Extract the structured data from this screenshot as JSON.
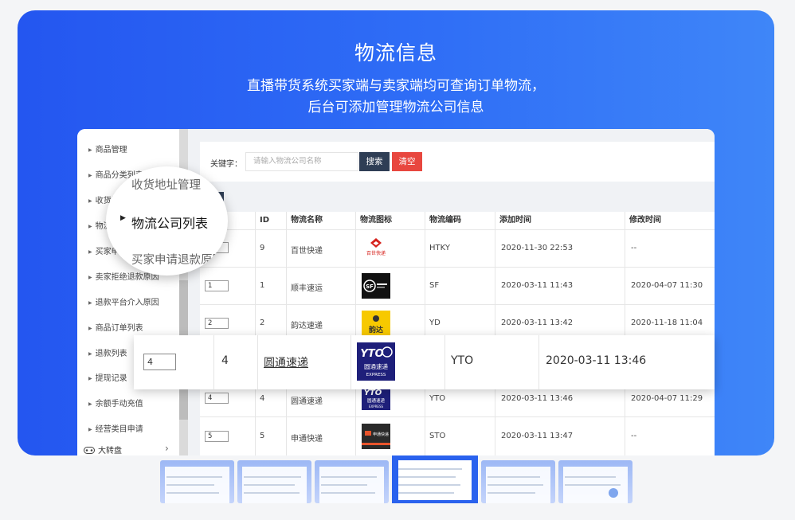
{
  "hero": {
    "title": "物流信息",
    "subtitle_line1": "直播带货系统买家端与卖家端均可查询订单物流，",
    "subtitle_line2": "后台可添加管理物流公司信息"
  },
  "sidebar": {
    "items": [
      "商品管理",
      "商品分类列表",
      "收货地址",
      "物流公",
      "买家申请",
      "卖家拒绝退款原因",
      "退款平台介入原因",
      "商品订单列表",
      "退款列表",
      "提现记录",
      "余额手动充值",
      "经营类目申请"
    ],
    "bottom": {
      "label": "大转盘",
      "icon": "gamepad-icon"
    }
  },
  "magnifier": {
    "items": [
      "收货地址管理",
      "物流公司列表",
      "买家申请退款原因"
    ],
    "active_index": 1
  },
  "search": {
    "label": "关键字：",
    "placeholder": "请输入物流公司名称",
    "search_btn": "搜索",
    "clear_btn": "清空"
  },
  "table": {
    "headers": [
      "ID",
      "物流名称",
      "物流图标",
      "物流编码",
      "添加时间",
      "修改时间"
    ],
    "rows": [
      {
        "order": "",
        "id": "9",
        "name": "百世快递",
        "icon": "best-express-logo",
        "code": "HTKY",
        "added": "2020-11-30 22:53",
        "modified": "--"
      },
      {
        "order": "1",
        "id": "1",
        "name": "顺丰速运",
        "icon": "sf-express-logo",
        "code": "SF",
        "added": "2020-03-11 11:43",
        "modified": "2020-04-07 11:30"
      },
      {
        "order": "2",
        "id": "2",
        "name": "韵达速递",
        "icon": "yunda-logo",
        "code": "YD",
        "added": "2020-03-11 13:42",
        "modified": "2020-11-18 11:04"
      },
      {
        "order": "4",
        "id": "4",
        "name": "圆通速递",
        "icon": "yto-express-logo",
        "code": "YTO",
        "added": "2020-03-11 13:46",
        "modified": "2020-04-07 11:29"
      },
      {
        "order": "5",
        "id": "5",
        "name": "申通快递",
        "icon": "sto-express-logo",
        "code": "STO",
        "added": "2020-03-11 13:47",
        "modified": "--"
      }
    ]
  },
  "zoom_row": {
    "order": "4",
    "id": "4",
    "name": "圆通速递",
    "code": "YTO",
    "added": "2020-03-11 13:46"
  },
  "logos": {
    "yto": "YTO",
    "yto_cn": "圆通速递",
    "express": "EXPRESS",
    "sf": "SF",
    "yunda": "韵达",
    "best_cn": "百世快递",
    "sto": "申通快递"
  },
  "thumbnails": {
    "count": 6,
    "active_index": 3
  }
}
